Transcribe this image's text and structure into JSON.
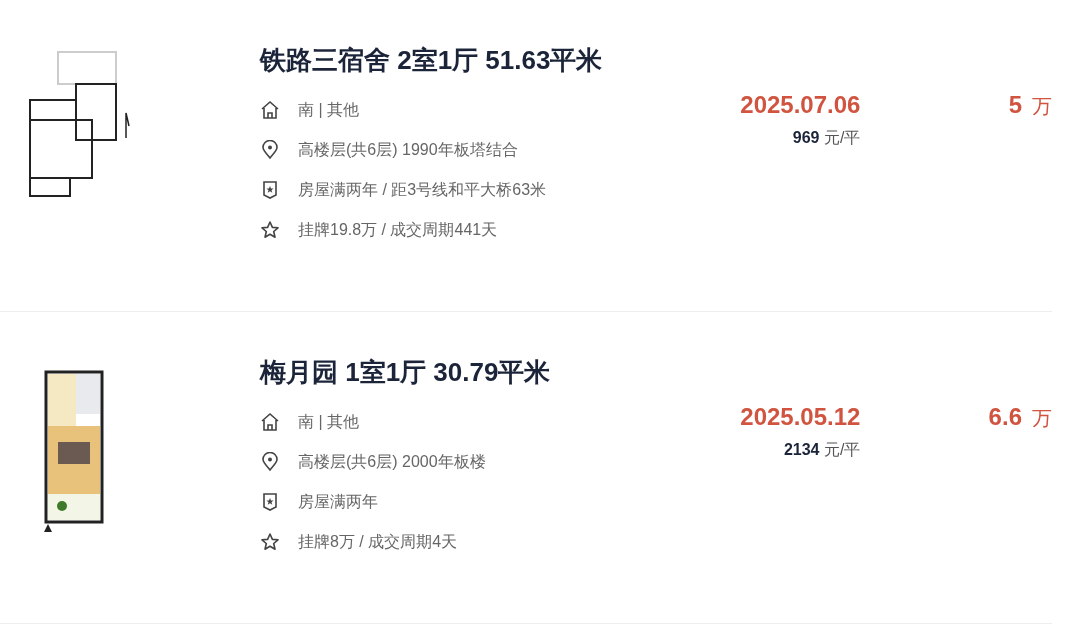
{
  "listings": [
    {
      "title": "铁路三宿舍 2室1厅 51.63平米",
      "info": [
        {
          "kind": "house",
          "text": "南 | 其他"
        },
        {
          "kind": "location",
          "text": "高楼层(共6层) 1990年板塔结合"
        },
        {
          "kind": "badge",
          "text": "房屋满两年 / 距3号线和平大桥63米"
        },
        {
          "kind": "star",
          "text": "挂牌19.8万 / 成交周期441天"
        }
      ],
      "deal_date": "2025.07.06",
      "unit_price": "969",
      "unit_price_unit": "元/平",
      "total_price": "5",
      "total_price_unit": "万"
    },
    {
      "title": "梅月园 1室1厅 30.79平米",
      "info": [
        {
          "kind": "house",
          "text": "南 | 其他"
        },
        {
          "kind": "location",
          "text": "高楼层(共6层) 2000年板楼"
        },
        {
          "kind": "badge",
          "text": "房屋满两年"
        },
        {
          "kind": "star",
          "text": "挂牌8万 / 成交周期4天"
        }
      ],
      "deal_date": "2025.05.12",
      "unit_price": "2134",
      "unit_price_unit": "元/平",
      "total_price": "6.6",
      "total_price_unit": "万"
    }
  ]
}
